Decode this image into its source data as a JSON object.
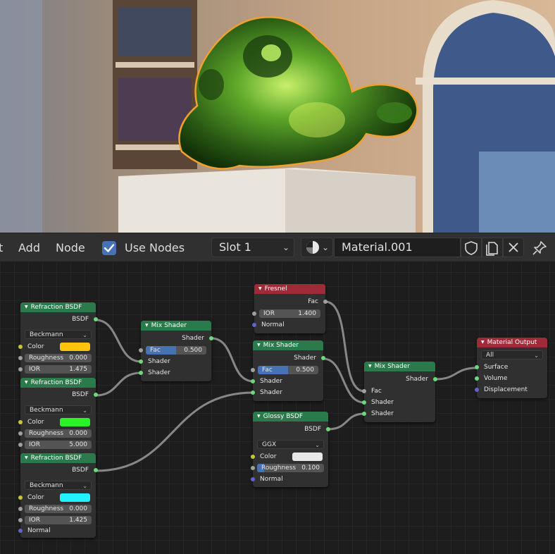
{
  "header": {
    "menu_cut": "t",
    "menu_add": "Add",
    "menu_node": "Node",
    "use_nodes_label": "Use Nodes",
    "use_nodes_checked": true,
    "slot": "Slot 1",
    "material_name": "Material.001"
  },
  "nodes": {
    "refraction1": {
      "title": "Refraction BSDF",
      "output": "BSDF",
      "distribution": "Beckmann",
      "color_label": "Color",
      "color": "#ffc20d",
      "roughness_label": "Roughness",
      "roughness": "0.000",
      "ior_label": "IOR",
      "ior": "1.475"
    },
    "refraction2": {
      "title": "Refraction BSDF",
      "output": "BSDF",
      "distribution": "Beckmann",
      "color_label": "Color",
      "color": "#28f528",
      "roughness_label": "Roughness",
      "roughness": "0.000",
      "ior_label": "IOR",
      "ior": "5.000"
    },
    "refraction3": {
      "title": "Refraction BSDF",
      "output": "BSDF",
      "distribution": "Beckmann",
      "color_label": "Color",
      "color": "#22f0ff",
      "roughness_label": "Roughness",
      "roughness": "0.000",
      "ior_label": "IOR",
      "ior": "1.425",
      "normal_label": "Normal"
    },
    "mix1": {
      "title": "Mix Shader",
      "output": "Shader",
      "fac_label": "Fac",
      "fac": "0.500",
      "fac_fraction": 0.5,
      "in1": "Shader",
      "in2": "Shader"
    },
    "fresnel": {
      "title": "Fresnel",
      "output": "Fac",
      "ior_label": "IOR",
      "ior": "1.400",
      "normal_label": "Normal"
    },
    "mix2": {
      "title": "Mix Shader",
      "output": "Shader",
      "fac_label": "Fac",
      "fac": "0.500",
      "fac_fraction": 0.5,
      "in1": "Shader",
      "in2": "Shader"
    },
    "glossy": {
      "title": "Glossy BSDF",
      "output": "BSDF",
      "distribution": "GGX",
      "color_label": "Color",
      "color": "#e8e8e8",
      "roughness_label": "Roughness",
      "roughness": "0.100",
      "roughness_fraction": 0.1,
      "normal_label": "Normal"
    },
    "mix3": {
      "title": "Mix Shader",
      "output": "Shader",
      "fac_label": "Fac",
      "in1": "Shader",
      "in2": "Shader"
    },
    "output": {
      "title": "Material Output",
      "target": "All",
      "surface_label": "Surface",
      "volume_label": "Volume",
      "displacement_label": "Displacement"
    }
  }
}
